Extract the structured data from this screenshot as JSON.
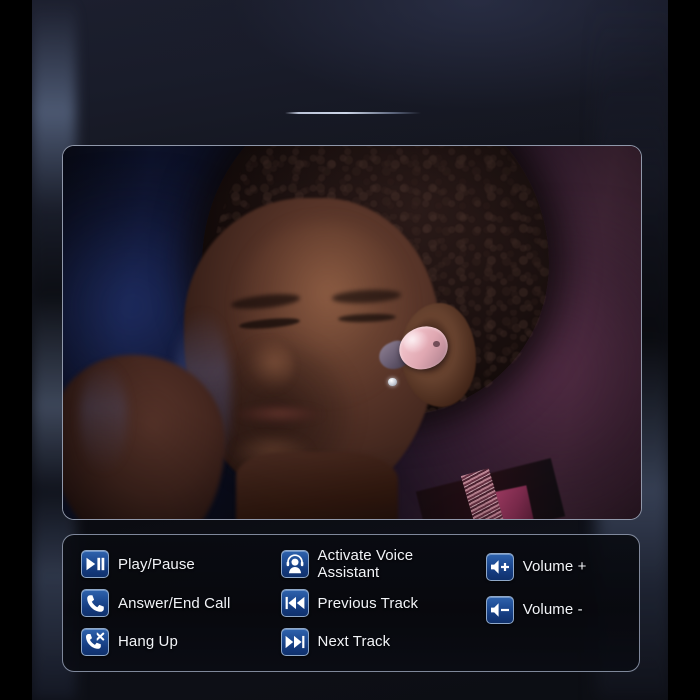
{
  "page": {
    "title": "Wireless Earbud Touch Control Guide",
    "background_color": "#0d0e14",
    "side_bar_color": "#000000",
    "accent_rule_color": "#cdd6e8"
  },
  "photo": {
    "caption": "Man wearing a pink wireless earbud in his right ear, eyes closed, hand raised",
    "border_color": "#bec8dc",
    "earbud_color": "#edbcc4",
    "backdrop_left_color": "#101633",
    "backdrop_right_color": "#4a2b3e"
  },
  "legend": {
    "border_color": "#b2bed6",
    "icon_color": "#1d4a92",
    "icon_border_color": "#8fa8c8",
    "label_color": "#f2f4f8",
    "columns": [
      {
        "items": [
          {
            "icon": "play-pause-icon",
            "label": "Play/Pause"
          },
          {
            "icon": "phone-answer-icon",
            "label": "Answer/End Call"
          },
          {
            "icon": "phone-hangup-icon",
            "label": "Hang Up"
          }
        ]
      },
      {
        "items": [
          {
            "icon": "voice-assistant-icon",
            "label": "Activate Voice\nAssistant"
          },
          {
            "icon": "previous-track-icon",
            "label": "Previous Track"
          },
          {
            "icon": "next-track-icon",
            "label": "Next Track"
          }
        ]
      },
      {
        "items": [
          {
            "icon": "volume-up-icon",
            "label": "Volume +"
          },
          {
            "icon": "volume-down-icon",
            "label": "Volume -"
          }
        ]
      }
    ]
  }
}
